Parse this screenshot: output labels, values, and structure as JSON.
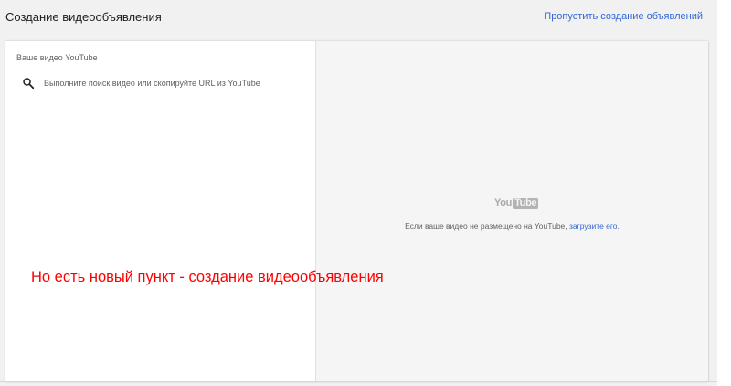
{
  "header": {
    "title": "Создание видеообъявления",
    "skip_link": "Пропустить создание объявлений"
  },
  "left_panel": {
    "section_label": "Ваше видео YouTube",
    "search": {
      "placeholder": "Выполните поиск видео или скопируйте URL из YouTube",
      "value": "",
      "icon": "search-icon"
    }
  },
  "right_panel": {
    "logo": {
      "word": "You",
      "box_word": "Tube"
    },
    "message_prefix": "Если ваше видео не размещено на YouTube, ",
    "upload_link": "загрузите его",
    "message_suffix": "."
  },
  "annotation": {
    "text": "Но есть новый пункт - создание видеообъявления",
    "color": "#ff0000"
  },
  "colors": {
    "link": "#3367d6",
    "background": "#f1f1f1",
    "preview_background": "#f5f5f5"
  }
}
